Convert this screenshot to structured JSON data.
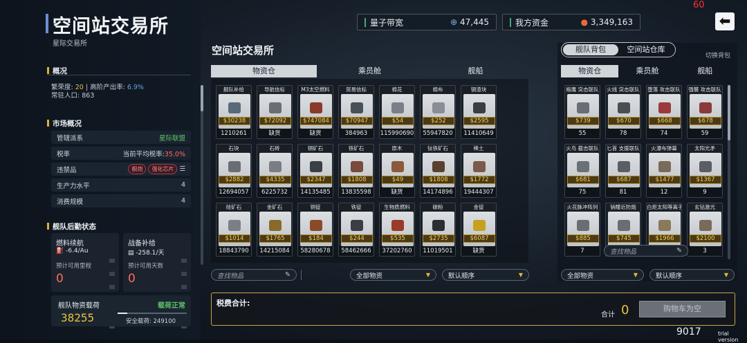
{
  "app": {
    "title": "空间站交易所",
    "subtitle": "星际交易所",
    "fps": "60",
    "trial": "trial version",
    "version": "9017"
  },
  "topbar": {
    "bandwidth_label": "量子带宽",
    "bandwidth_value": "47,445",
    "funds_label": "我方资金",
    "funds_value": "3,349,163"
  },
  "overview": {
    "heading": "概况",
    "prosperity_label": "繁荣度:",
    "prosperity_value": "20",
    "sep": "|",
    "output_label": "高阶产出率:",
    "output_value": "6.9%",
    "population_label": "常驻人口:",
    "population_value": "863"
  },
  "market": {
    "heading": "市场概况",
    "rows": [
      {
        "label": "管辖派系",
        "value": "星际联盟"
      },
      {
        "label": "税率",
        "value_prefix": "当前平均税率:",
        "value": "35.0%"
      },
      {
        "label": "违禁品",
        "badges": [
          "舰炮",
          "强化芯片"
        ],
        "more": "☰"
      },
      {
        "label": "生产力水平",
        "value": "4"
      },
      {
        "label": "消费规模",
        "value": "4"
      }
    ]
  },
  "fleet": {
    "heading": "舰队后勤状态",
    "fuel": {
      "title": "燃料续航",
      "rate": "-6.4/Au",
      "sub": "预计可用里程",
      "value": "0"
    },
    "supply": {
      "title": "战备补给",
      "rate": "-258.1/天",
      "sub": "预计可用天数",
      "value": "0"
    },
    "load": {
      "title": "舰队物资载荷",
      "status": "载荷正常",
      "value": "38255",
      "safe_label": "安全载荷:",
      "safe_value": "249100"
    }
  },
  "exchange": {
    "title": "空间站交易所",
    "tabs": [
      "物资仓",
      "乘员舱",
      "舰船"
    ],
    "items": [
      {
        "name": "舰队补给",
        "price": "$30238",
        "qty": "1210261"
      },
      {
        "name": "导航信标",
        "price": "$72092",
        "qty": "缺货"
      },
      {
        "name": "M3太空燃料",
        "price": "$747084",
        "qty": "缺货"
      },
      {
        "name": "贸易信标",
        "price": "$70947",
        "qty": "384963"
      },
      {
        "name": "棉花",
        "price": "$54",
        "qty": "115990690"
      },
      {
        "name": "棉布",
        "price": "$252",
        "qty": "55947820"
      },
      {
        "name": "钢渣块",
        "price": "$2595",
        "qty": "11410649"
      },
      {
        "name": "石块",
        "price": "$2882",
        "qty": "12694057"
      },
      {
        "name": "石砖",
        "price": "$4335",
        "qty": "6225732"
      },
      {
        "name": "铜矿石",
        "price": "$2347",
        "qty": "14135485"
      },
      {
        "name": "铁矿石",
        "price": "$1808",
        "qty": "13835598"
      },
      {
        "name": "原木",
        "price": "$49",
        "qty": "缺货"
      },
      {
        "name": "钛铁矿石",
        "price": "$1808",
        "qty": "14174896"
      },
      {
        "name": "稀土",
        "price": "$1772",
        "qty": "19444307"
      },
      {
        "name": "硅矿石",
        "price": "$1014",
        "qty": "18843790"
      },
      {
        "name": "金矿石",
        "price": "$1765",
        "qty": "14215084"
      },
      {
        "name": "铜锭",
        "price": "$184",
        "qty": "58280678"
      },
      {
        "name": "铁锭",
        "price": "$244",
        "qty": "58462666"
      },
      {
        "name": "生物质燃料",
        "price": "$535",
        "qty": "37202760"
      },
      {
        "name": "碳粉",
        "price": "$2735",
        "qty": "11019501"
      },
      {
        "name": "金锭",
        "price": "$6087",
        "qty": "缺货"
      }
    ],
    "search_placeholder": "查找物品",
    "filter": "全部物资",
    "sort": "默认顺序"
  },
  "tax": {
    "label": "税费合计:",
    "total_label": "合计",
    "total_value": "0",
    "cart_button": "购物车为空"
  },
  "inventory": {
    "switch": [
      "舰队背包",
      "空间站仓库"
    ],
    "toggle_label": "切换背包",
    "tabs": [
      "物资仓",
      "乘员舱",
      "舰船"
    ],
    "items": [
      {
        "name": "格鹰 突击联队",
        "price": "$739",
        "qty": "55"
      },
      {
        "name": "火线 突击联队",
        "price": "$670",
        "qty": "78"
      },
      {
        "name": "堕落 攻击联队",
        "price": "$668",
        "qty": "74"
      },
      {
        "name": "强襲 攻击联队",
        "price": "$678",
        "qty": "59"
      },
      {
        "name": "火鸟 截击联队",
        "price": "$681",
        "qty": "75"
      },
      {
        "name": "匕首 支援联队",
        "price": "$687",
        "qty": "81"
      },
      {
        "name": "火瀑布弹幕",
        "price": "$1477",
        "qty": "12"
      },
      {
        "name": "太阳光矛",
        "price": "$1367",
        "qty": "9"
      },
      {
        "name": "火花脉冲阵列",
        "price": "$885",
        "qty": "7"
      },
      {
        "name": "钠瞳近防炮",
        "price": "$745",
        "qty": ""
      },
      {
        "name": "白炬太阳等离子",
        "price": "$1966",
        "qty": ""
      },
      {
        "name": "玄钻激光",
        "price": "$2100",
        "qty": "3"
      }
    ],
    "search_placeholder": "查找物品",
    "filter": "全部物资",
    "sort": "默认顺序"
  }
}
